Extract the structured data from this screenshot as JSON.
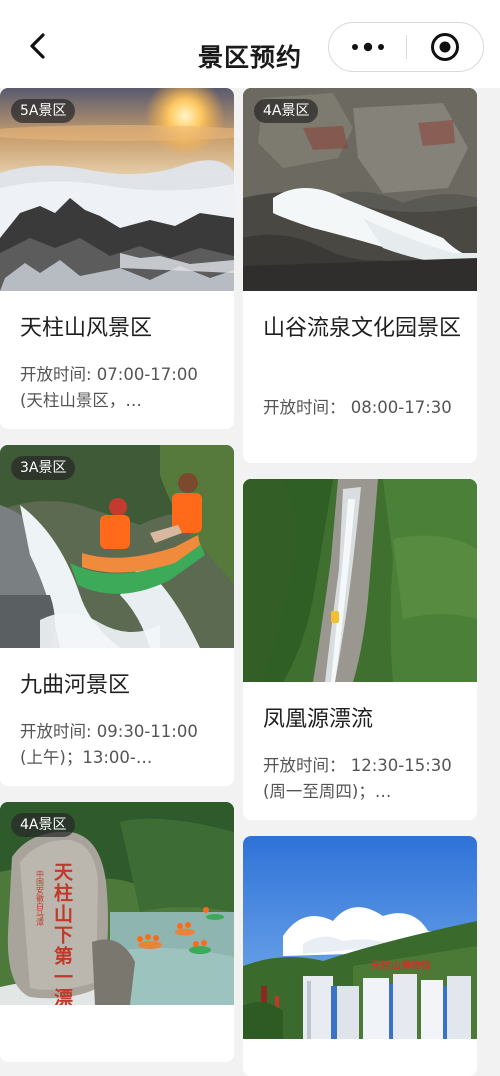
{
  "header": {
    "title": "景区预约",
    "back_icon": "chevron-left-icon",
    "more_icon": "more-dots-icon",
    "close_icon": "target-close-icon"
  },
  "left_column": [
    {
      "badge": "5A景区",
      "name": "天柱山风景区",
      "hours": "开放时间: 07:00-17:00(天柱山景区，…"
    },
    {
      "badge": "3A景区",
      "name": "九曲河景区",
      "hours": "开放时间: 09:30-11:00(上午)；13:00-…"
    },
    {
      "badge": "4A景区",
      "name": "",
      "hours": ""
    }
  ],
  "right_column": [
    {
      "badge": "4A景区",
      "name": "山谷流泉文化园景区",
      "hours": "开放时间：  08:00-17:30"
    },
    {
      "badge": "",
      "name": "凤凰源漂流",
      "hours": "开放时间：  12:30-15:30(周一至周四)；…"
    },
    {
      "badge": "",
      "name": "",
      "hours": ""
    }
  ],
  "photo_texts": {
    "rock_carving": "天柱山下第一漂",
    "rock_carving_side": "中国安徽白马潭",
    "museum_sign": "天柱山博物馆"
  },
  "colors": {
    "page_bg": "#f2f2f2",
    "card_bg": "#ffffff",
    "badge_bg": "rgba(40,40,40,0.72)",
    "carving_red": "#c0392b"
  }
}
